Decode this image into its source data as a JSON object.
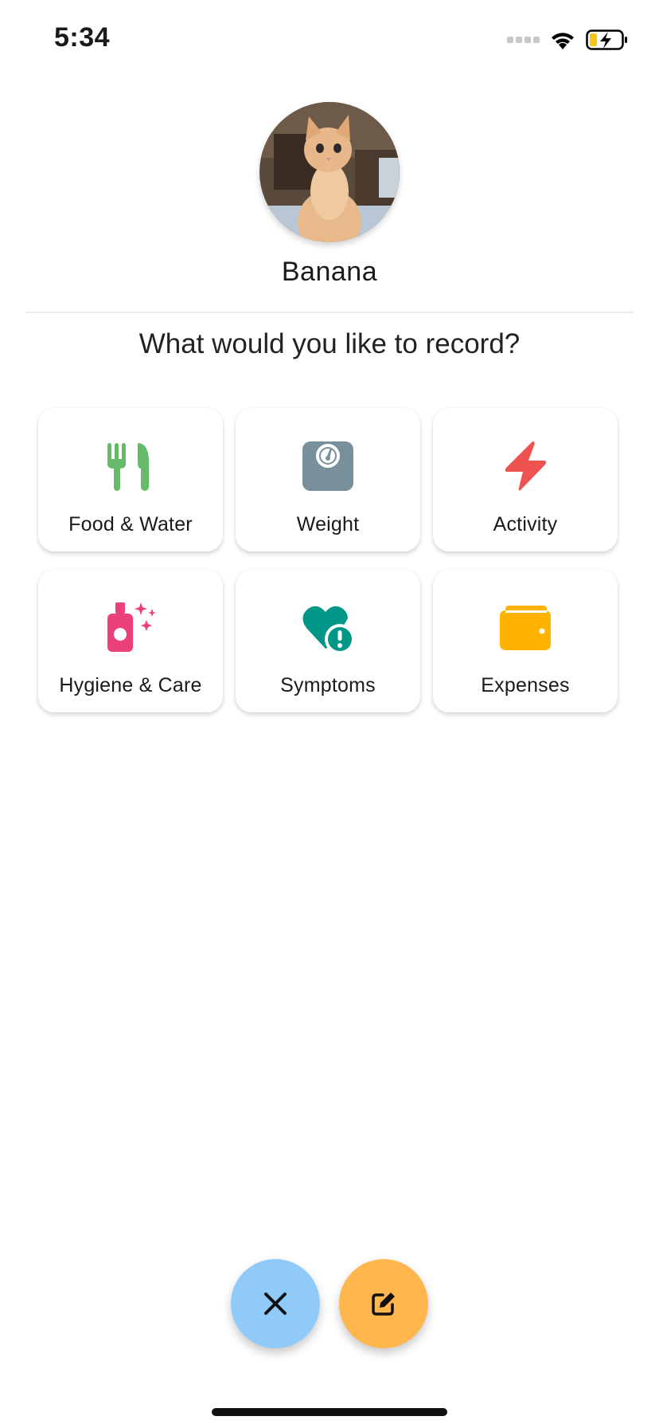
{
  "status_bar": {
    "time": "5:34",
    "icons": [
      "signal-icon",
      "wifi-icon",
      "battery-charging-icon"
    ]
  },
  "pet": {
    "name": "Banana",
    "avatar": "kitten-photo"
  },
  "prompt": "What would you like to record?",
  "categories": [
    {
      "label": "Food & Water",
      "icon": "utensils-icon",
      "color": "#66bb6a"
    },
    {
      "label": "Weight",
      "icon": "scale-icon",
      "color": "#78909c"
    },
    {
      "label": "Activity",
      "icon": "bolt-icon",
      "color": "#ef5350"
    },
    {
      "label": "Hygiene & Care",
      "icon": "spray-bottle-icon",
      "color": "#ec407a"
    },
    {
      "label": "Symptoms",
      "icon": "heart-alert-icon",
      "color": "#009688"
    },
    {
      "label": "Expenses",
      "icon": "wallet-icon",
      "color": "#ffb300"
    }
  ],
  "actions": {
    "close": {
      "icon": "close-icon",
      "color": "#90caf9"
    },
    "edit": {
      "icon": "edit-icon",
      "color": "#ffb74d"
    }
  }
}
